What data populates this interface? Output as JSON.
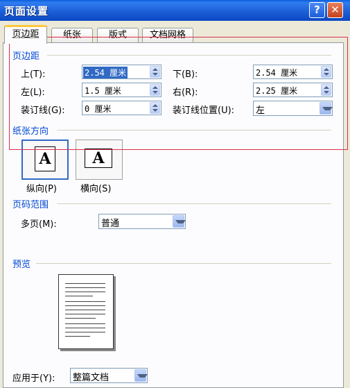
{
  "window": {
    "title": "页面设置",
    "help": "?",
    "close": "✕"
  },
  "tabs": [
    {
      "label": "页边距",
      "active": true
    },
    {
      "label": "纸张"
    },
    {
      "label": "版式"
    },
    {
      "label": "文档网格"
    }
  ],
  "margins": {
    "section": "页边距",
    "top_label": "上(T):",
    "top_value": "2.54 厘米",
    "bottom_label": "下(B):",
    "bottom_value": "2.54 厘米",
    "left_label": "左(L):",
    "left_value": "1.5 厘米",
    "right_label": "右(R):",
    "right_value": "2.25 厘米",
    "gutter_label": "装订线(G):",
    "gutter_value": "0 厘米",
    "gutter_pos_label": "装订线位置(U):",
    "gutter_pos_value": "左"
  },
  "orientation": {
    "section": "纸张方向",
    "portrait_icon": "A",
    "portrait_label": "纵向(P)",
    "landscape_icon": "A",
    "landscape_label": "横向(S)"
  },
  "pages": {
    "section": "页码范围",
    "multi_label": "多页(M):",
    "multi_value": "普通"
  },
  "preview": {
    "section": "预览"
  },
  "apply": {
    "label": "应用于(Y):",
    "value": "整篇文档"
  },
  "colors": {
    "title_bar": "#0a48c4",
    "section_text": "#0046d5",
    "highlight": "#d9304d"
  }
}
